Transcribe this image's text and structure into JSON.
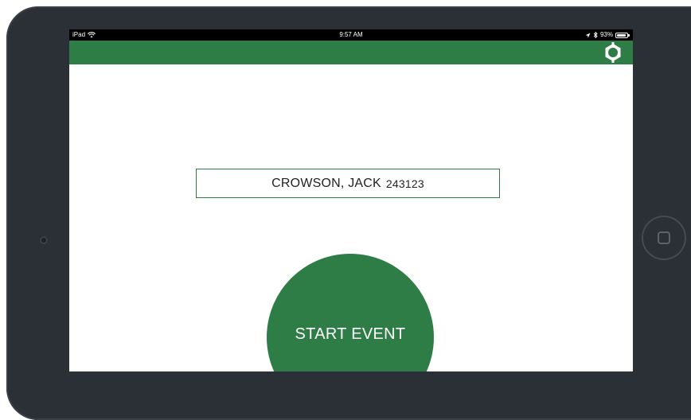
{
  "status_bar": {
    "device": "iPad",
    "time": "9:57 AM",
    "battery_percent": "93%",
    "battery_level": 0.93
  },
  "header": {
    "color": "#2e7d46",
    "settings_icon": "gear-icon"
  },
  "patient": {
    "name": "CROWSON, JACK",
    "id": "243123"
  },
  "start_event_button": {
    "label": "START EVENT"
  },
  "colors": {
    "accent": "#2e7d46",
    "bezel": "#2b2f36"
  }
}
